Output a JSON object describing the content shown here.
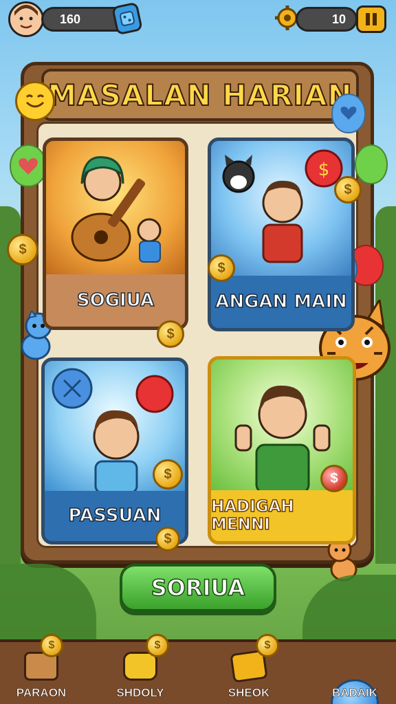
{
  "header": {
    "currency_value": "160",
    "energy_value": "10"
  },
  "board": {
    "title": "MASALAN HARIAN"
  },
  "cards": [
    {
      "label": "SOGIUA",
      "theme": "orange"
    },
    {
      "label": "ANGAN MAIN",
      "theme": "blue"
    },
    {
      "label": "PASSUAN",
      "theme": "blue"
    },
    {
      "label": "HADIGAH MENNI",
      "theme": "yellow"
    }
  ],
  "play_button": {
    "label": "SORIUA"
  },
  "bottom_nav": [
    {
      "label": "PARAON",
      "icon": "crate-icon"
    },
    {
      "label": "SHDOLY",
      "icon": "chat-coin-icon"
    },
    {
      "label": "SHEOK",
      "icon": "ticket-icon"
    },
    {
      "label": "BADAIK",
      "icon": "face-bubble-icon"
    }
  ],
  "colors": {
    "accent_gold": "#ffd84a",
    "play_green": "#3aa22b",
    "card_blue": "#2e6fb0",
    "card_orange": "#e8962c",
    "card_yellow": "#f2c428"
  }
}
